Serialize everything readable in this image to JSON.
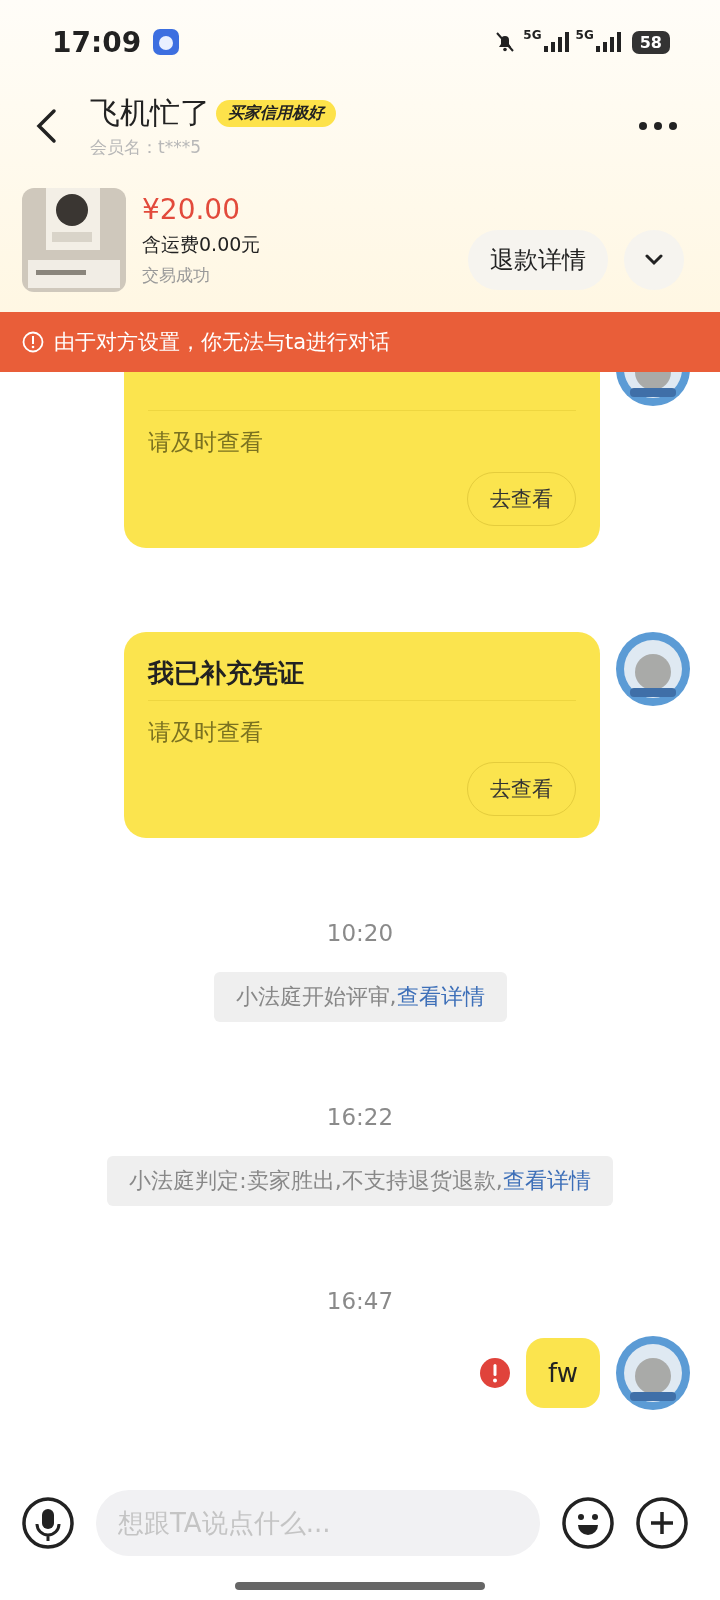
{
  "status_bar": {
    "time": "17:09",
    "network_1": "5G",
    "network_2": "5G",
    "battery": "58"
  },
  "header": {
    "title": "飞机忙了",
    "badge": "买家信用极好",
    "member": "会员名：t***5"
  },
  "order": {
    "price": "¥20.00",
    "shipping": "含运费0.00元",
    "status": "交易成功",
    "refund_button": "退款详情"
  },
  "notice": "由于对方设置，你无法与ta进行对话",
  "messages": [
    {
      "kind": "card",
      "body": "请及时查看",
      "button": "去查看"
    },
    {
      "kind": "card",
      "title": "我已补充凭证",
      "body": "请及时查看",
      "button": "去查看"
    },
    {
      "kind": "time",
      "text": "10:20"
    },
    {
      "kind": "system",
      "text": "小法庭开始评审,",
      "link": "查看详情"
    },
    {
      "kind": "time",
      "text": "16:22"
    },
    {
      "kind": "system",
      "text": "小法庭判定:卖家胜出,不支持退货退款,",
      "link": "查看详情"
    },
    {
      "kind": "time",
      "text": "16:47"
    },
    {
      "kind": "text",
      "text": "fw",
      "failed": true
    }
  ],
  "composer": {
    "placeholder": "想跟TA说点什么..."
  }
}
